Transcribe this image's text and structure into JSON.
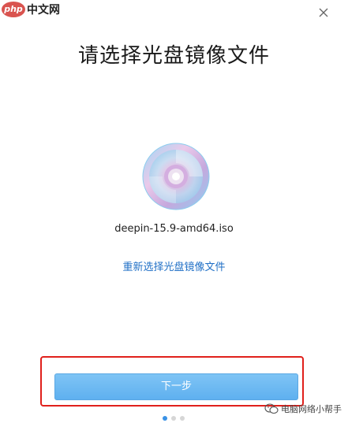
{
  "watermark": {
    "logo_php": "php",
    "logo_text": "中文网",
    "wechat_text": "电脑网络小帮手"
  },
  "header": {
    "title": "请选择光盘镜像文件"
  },
  "main": {
    "file_name": "deepin-15.9-amd64.iso",
    "reselect_link": "重新选择光盘镜像文件",
    "next_button": "下一步"
  },
  "pagination": {
    "total": 3,
    "current": 1
  },
  "colors": {
    "accent": "#1f6fc6",
    "button": "#6ab8f2",
    "highlight_border": "#e0201b"
  },
  "icons": {
    "close": "close-icon",
    "disc": "disc-icon",
    "wechat": "wechat-icon"
  }
}
